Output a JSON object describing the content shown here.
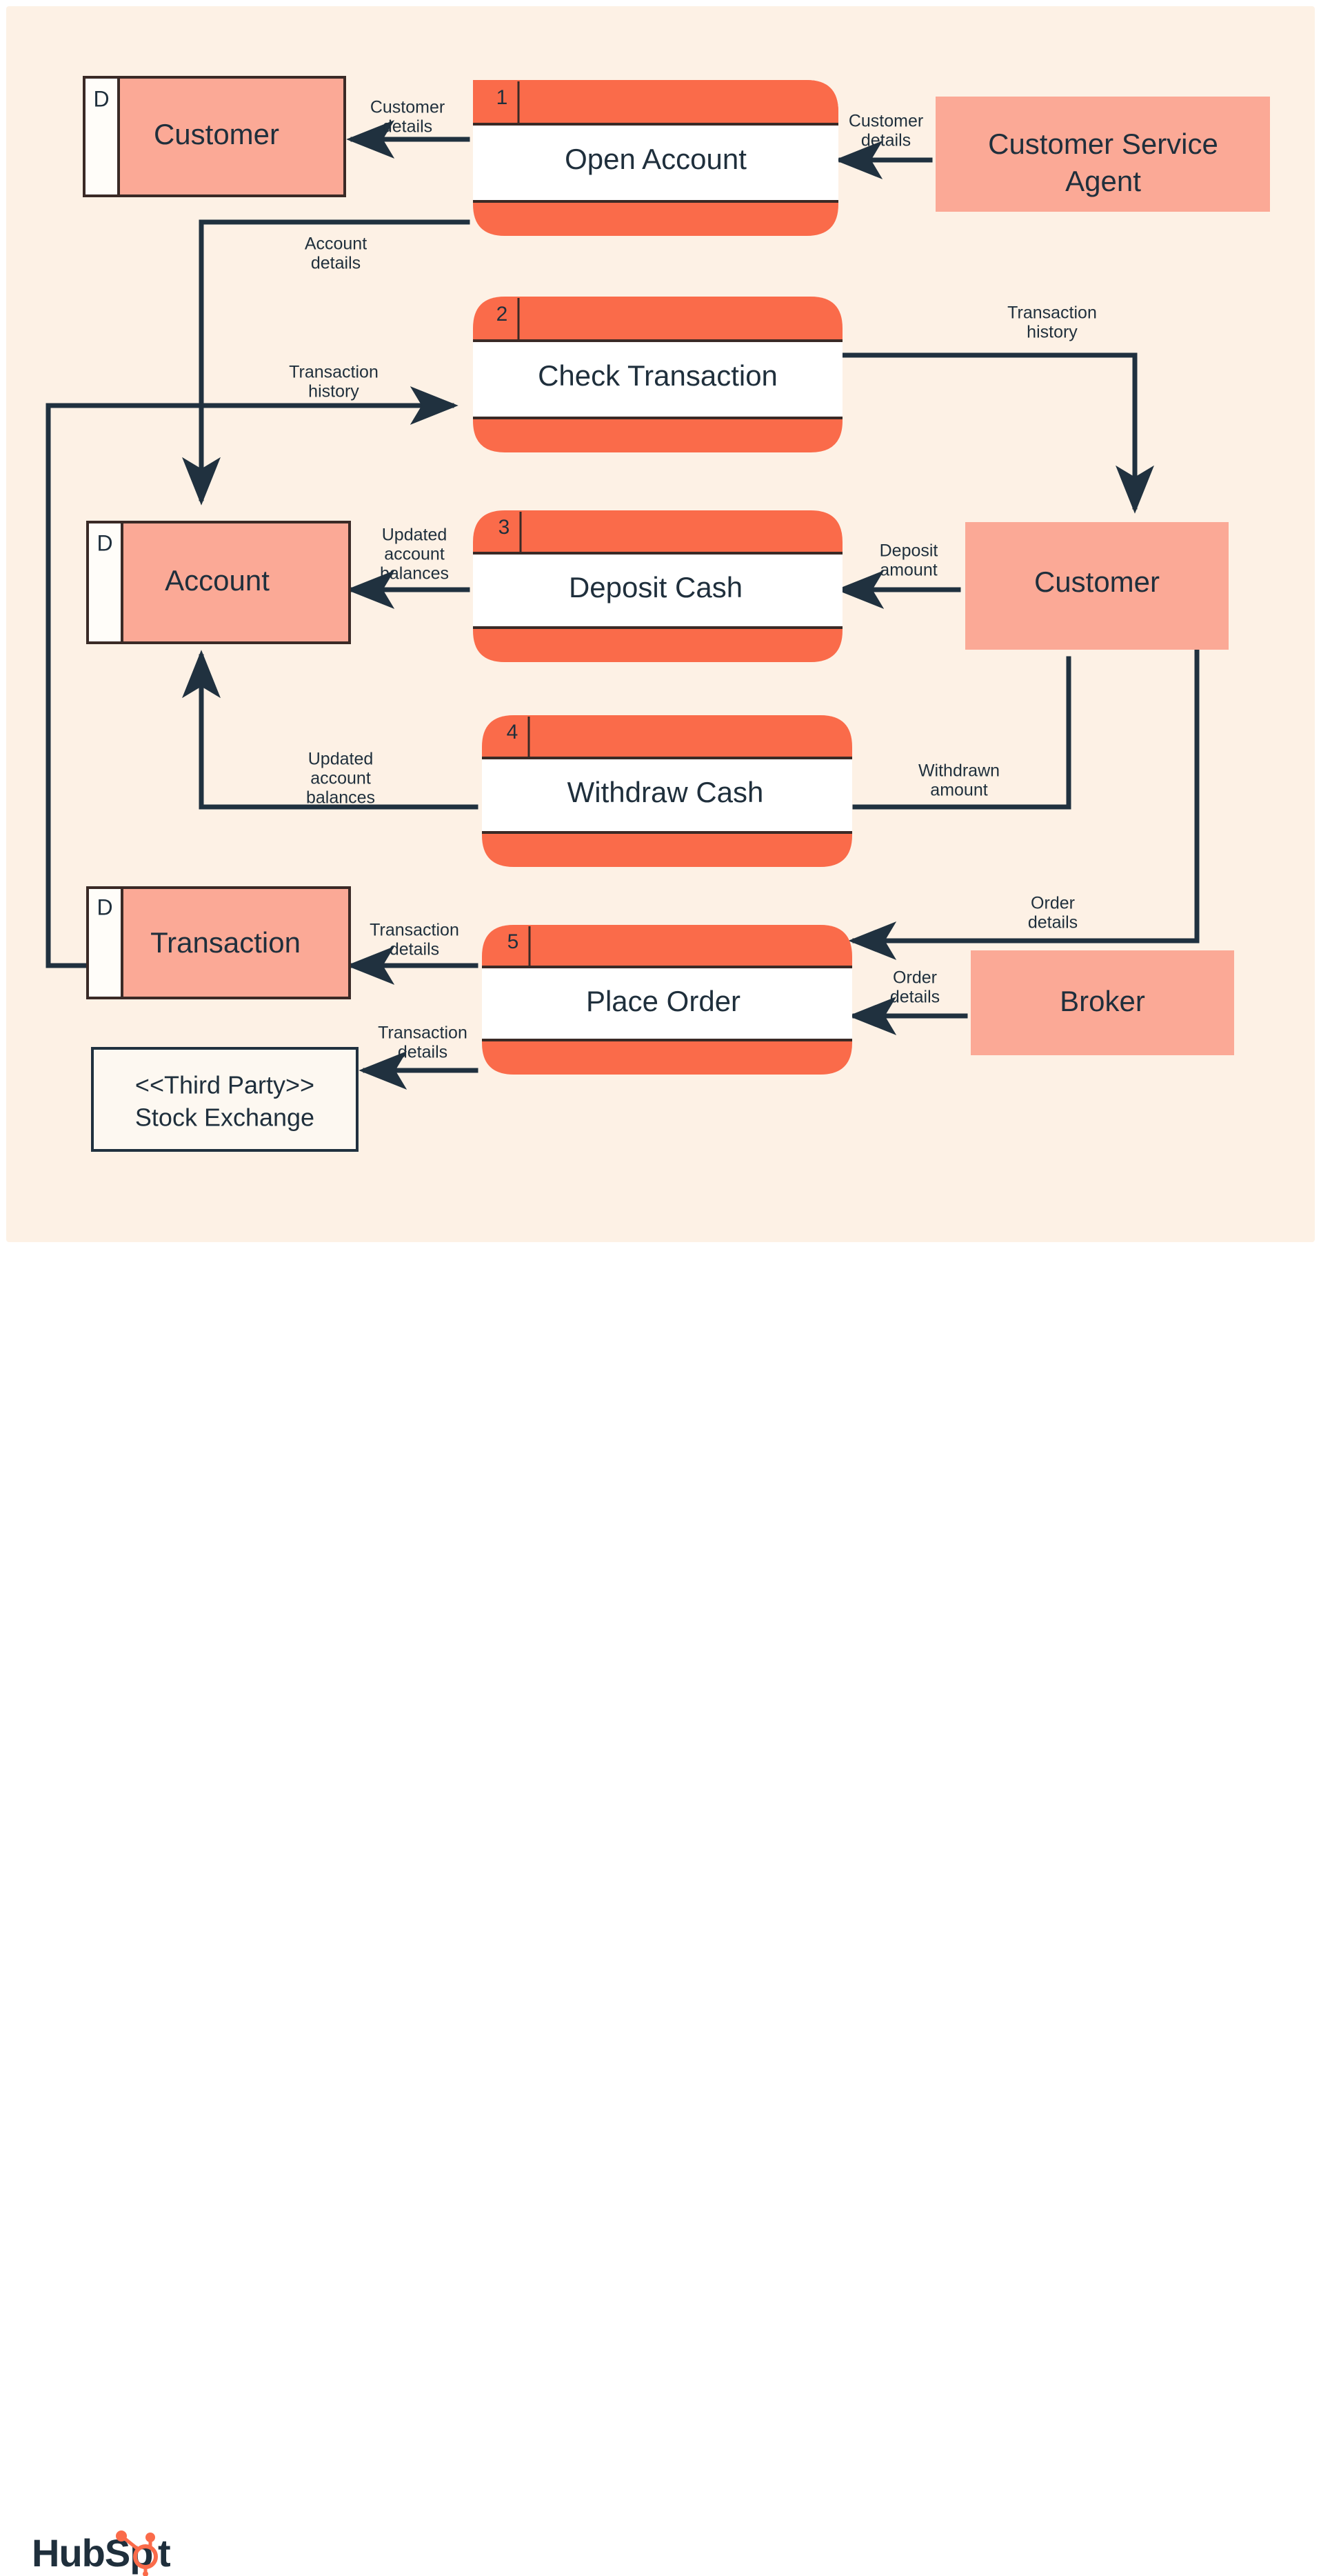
{
  "diagram": {
    "title": "Banking System Data Flow Diagram",
    "colors": {
      "background": "#fdf1e5",
      "process_accent": "#fa6b4a",
      "entity_fill": "#fba996",
      "line": "#20313f",
      "text": "#1f2f3c"
    },
    "processes": [
      {
        "number": "1",
        "label": "Open Account"
      },
      {
        "number": "2",
        "label": "Check Transaction"
      },
      {
        "number": "3",
        "label": "Deposit Cash"
      },
      {
        "number": "4",
        "label": "Withdraw Cash"
      },
      {
        "number": "5",
        "label": "Place Order"
      }
    ],
    "data_stores": [
      {
        "marker": "D",
        "label": "Customer"
      },
      {
        "marker": "D",
        "label": "Account"
      },
      {
        "marker": "D",
        "label": "Transaction"
      }
    ],
    "external_entities": [
      {
        "label": "Customer Service Agent",
        "line1": "Customer Service",
        "line2": "Agent"
      },
      {
        "label": "Customer"
      },
      {
        "label": "Broker"
      },
      {
        "label": "<<Third Party>> Stock Exchange",
        "line1": "<<Third Party>>",
        "line2": "Stock Exchange"
      }
    ],
    "flow_labels": {
      "customer_details_out": "Customer\ndetails",
      "customer_details_in_1": "Customer",
      "customer_details_in_2": "details",
      "customer_details_out_1": "Customer",
      "customer_details_out_2": "details",
      "account_details_1": "Account",
      "account_details_2": "details",
      "transaction_history_left_1": "Transaction",
      "transaction_history_left_2": "history",
      "transaction_history_right_1": "Transaction",
      "transaction_history_right_2": "history",
      "updated_balances_3_1": "Updated",
      "updated_balances_3_2": "account",
      "updated_balances_3_3": "balances",
      "deposit_amount_1": "Deposit",
      "deposit_amount_2": "amount",
      "updated_balances_4_1": "Updated",
      "updated_balances_4_2": "account",
      "updated_balances_4_3": "balances",
      "withdrawn_amount_1": "Withdrawn",
      "withdrawn_amount_2": "amount",
      "order_details_top_1": "Order",
      "order_details_top_2": "details",
      "order_details_broker_1": "Order",
      "order_details_broker_2": "details",
      "transaction_details_store_1": "Transaction",
      "transaction_details_store_2": "details",
      "transaction_details_exch_1": "Transaction",
      "transaction_details_exch_2": "details"
    }
  },
  "footer": {
    "logo_text": "HubSp",
    "logo_text_end": "t",
    "brand": "HubSpot"
  }
}
